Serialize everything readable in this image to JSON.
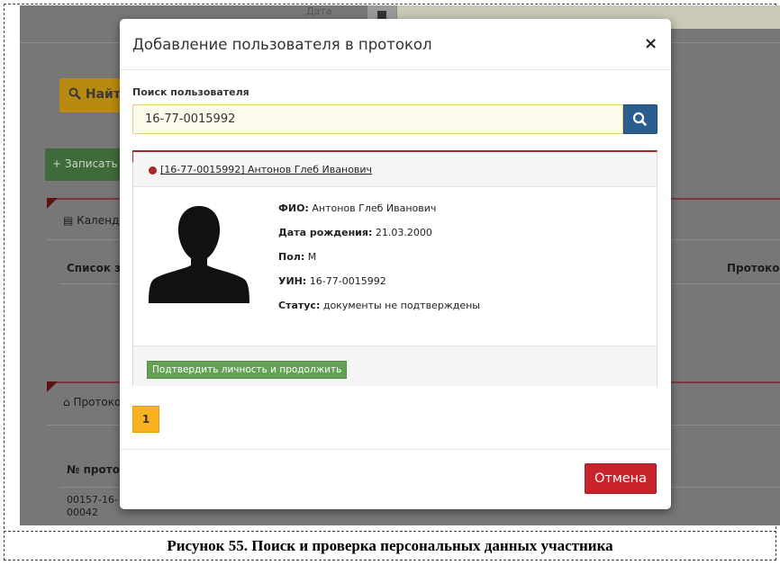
{
  "background": {
    "date_label": "Дата",
    "find_button": "Найти",
    "record_button": "Записать",
    "calendar_panel_title": "Календарь",
    "list_column": "Список з",
    "protocol_column": "Протоко",
    "protocols_panel_title": "Протоколы",
    "number_column": "№ протокола",
    "row_cell_line1": "00157-16-",
    "row_cell_line2": "00042"
  },
  "modal": {
    "title": "Добавление пользователя в протокол",
    "close_symbol": "×",
    "search_label": "Поиск пользователя",
    "search_value": "16-77-0015992",
    "result": {
      "header_link": "[16-77-0015992] Антонов Глеб Иванович",
      "fio_label": "ФИО:",
      "fio_value": "Антонов Глеб Иванович",
      "birth_label": "Дата рождения:",
      "birth_value": "21.03.2000",
      "gender_label": "Пол:",
      "gender_value": "М",
      "uin_label": "УИН:",
      "uin_value": "16-77-0015992",
      "status_label": "Статус:",
      "status_value": "документы не подтверждены",
      "confirm_button": "Подтвердить личность и продолжить"
    },
    "pagination": {
      "current_page": "1"
    },
    "cancel_button": "Отмена"
  },
  "caption": "Рисунок 55. Поиск и проверка персональных данных участника",
  "colors": {
    "accent_red": "#a52828",
    "search_button": "#2c5d8f",
    "confirm_green": "#63a254",
    "cancel_red": "#c8222a",
    "page_yellow": "#f8b21d"
  },
  "icons": {
    "search": "search-icon",
    "calendar": "calendar-icon",
    "home": "home-icon",
    "plus": "plus-icon",
    "avatar": "person-silhouette-icon"
  }
}
